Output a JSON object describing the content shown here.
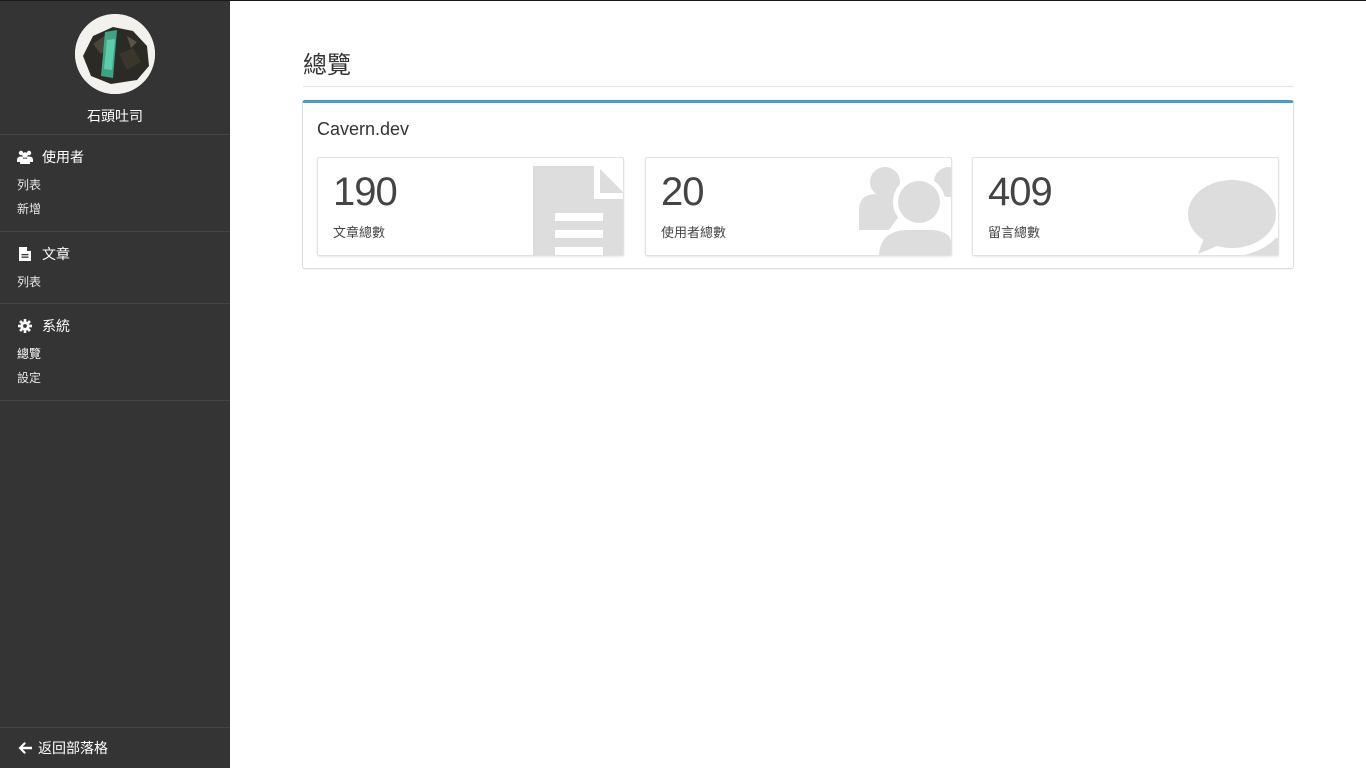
{
  "sidebar": {
    "username": "石頭吐司",
    "sections": [
      {
        "title": "使用者",
        "icon": "users-icon",
        "items": [
          "列表",
          "新增"
        ]
      },
      {
        "title": "文章",
        "icon": "file-icon",
        "items": [
          "列表"
        ]
      },
      {
        "title": "系統",
        "icon": "gear-icon",
        "items": [
          "總覽",
          "設定"
        ]
      }
    ],
    "back_label": "返回部落格"
  },
  "main": {
    "page_title": "總覽",
    "box_title": "Cavern.dev",
    "stats": [
      {
        "value": "190",
        "label": "文章總數",
        "icon": "document-icon"
      },
      {
        "value": "20",
        "label": "使用者總數",
        "icon": "users-icon"
      },
      {
        "value": "409",
        "label": "留言總數",
        "icon": "comment-icon"
      }
    ]
  },
  "colors": {
    "sidebar_bg": "#343434",
    "box_accent": "#3aa0d6",
    "stat_icon": "#dddddd"
  }
}
